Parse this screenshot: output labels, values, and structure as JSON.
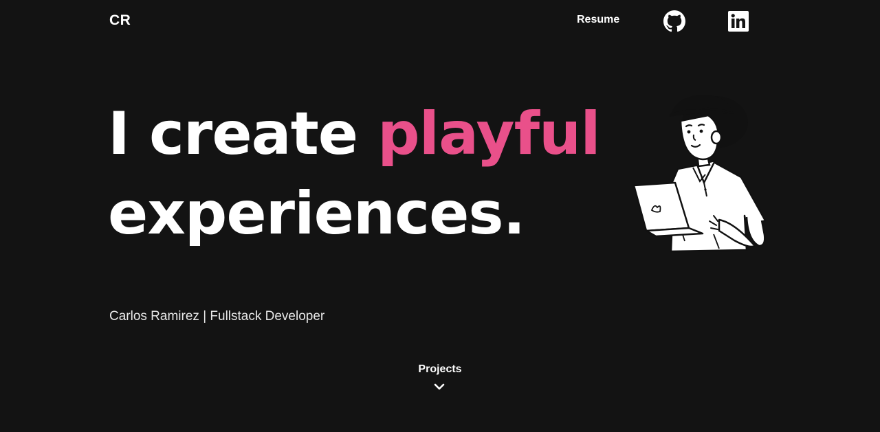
{
  "header": {
    "logo": "CR",
    "nav": {
      "resume_label": "Resume",
      "github_icon": "github-icon",
      "linkedin_icon": "linkedin-icon"
    }
  },
  "hero": {
    "line1_prefix": "I create ",
    "line1_accent": "playful",
    "line2": "experiences.",
    "subtitle": "Carlos Ramirez | Fullstack Developer",
    "illustration_icon": "developer-with-laptop-illustration"
  },
  "scroll": {
    "label": "Projects",
    "icon": "chevron-down-icon"
  },
  "colors": {
    "background": "#131313",
    "text": "#ffffff",
    "accent": "#e9508a"
  }
}
